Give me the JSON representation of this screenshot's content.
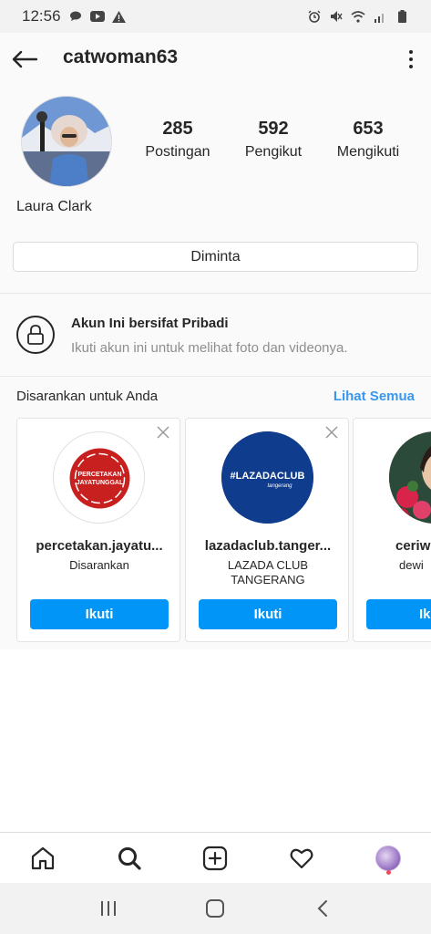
{
  "status_bar": {
    "time": "12:56"
  },
  "header": {
    "username": "catwoman63"
  },
  "profile": {
    "full_name": "Laura Clark",
    "stats": [
      {
        "value": "285",
        "label": "Postingan"
      },
      {
        "value": "592",
        "label": "Pengikut"
      },
      {
        "value": "653",
        "label": "Mengikuti"
      }
    ],
    "requested_label": "Diminta"
  },
  "private_notice": {
    "title": "Akun Ini bersifat Pribadi",
    "subtitle": "Ikuti akun ini untuk melihat foto dan videonya."
  },
  "suggestions": {
    "title": "Disarankan untuk Anda",
    "see_all": "Lihat Semua",
    "cards": [
      {
        "name": "percetakan.jayatu...",
        "subtitle": "Disarankan",
        "button": "Ikuti",
        "logo_text": "PERCETAKAN JAYATUNGGAL"
      },
      {
        "name": "lazadaclub.tanger...",
        "subtitle": "LAZADA CLUB TANGERANG",
        "button": "Ikuti",
        "logo_text": "#LAZADACLUB tangerang"
      },
      {
        "name": "ceriw",
        "subtitle": "dewi",
        "button": "Ik"
      }
    ]
  },
  "colors": {
    "accent": "#0095f6",
    "link": "#3897f0",
    "muted": "#8e8e8e"
  }
}
